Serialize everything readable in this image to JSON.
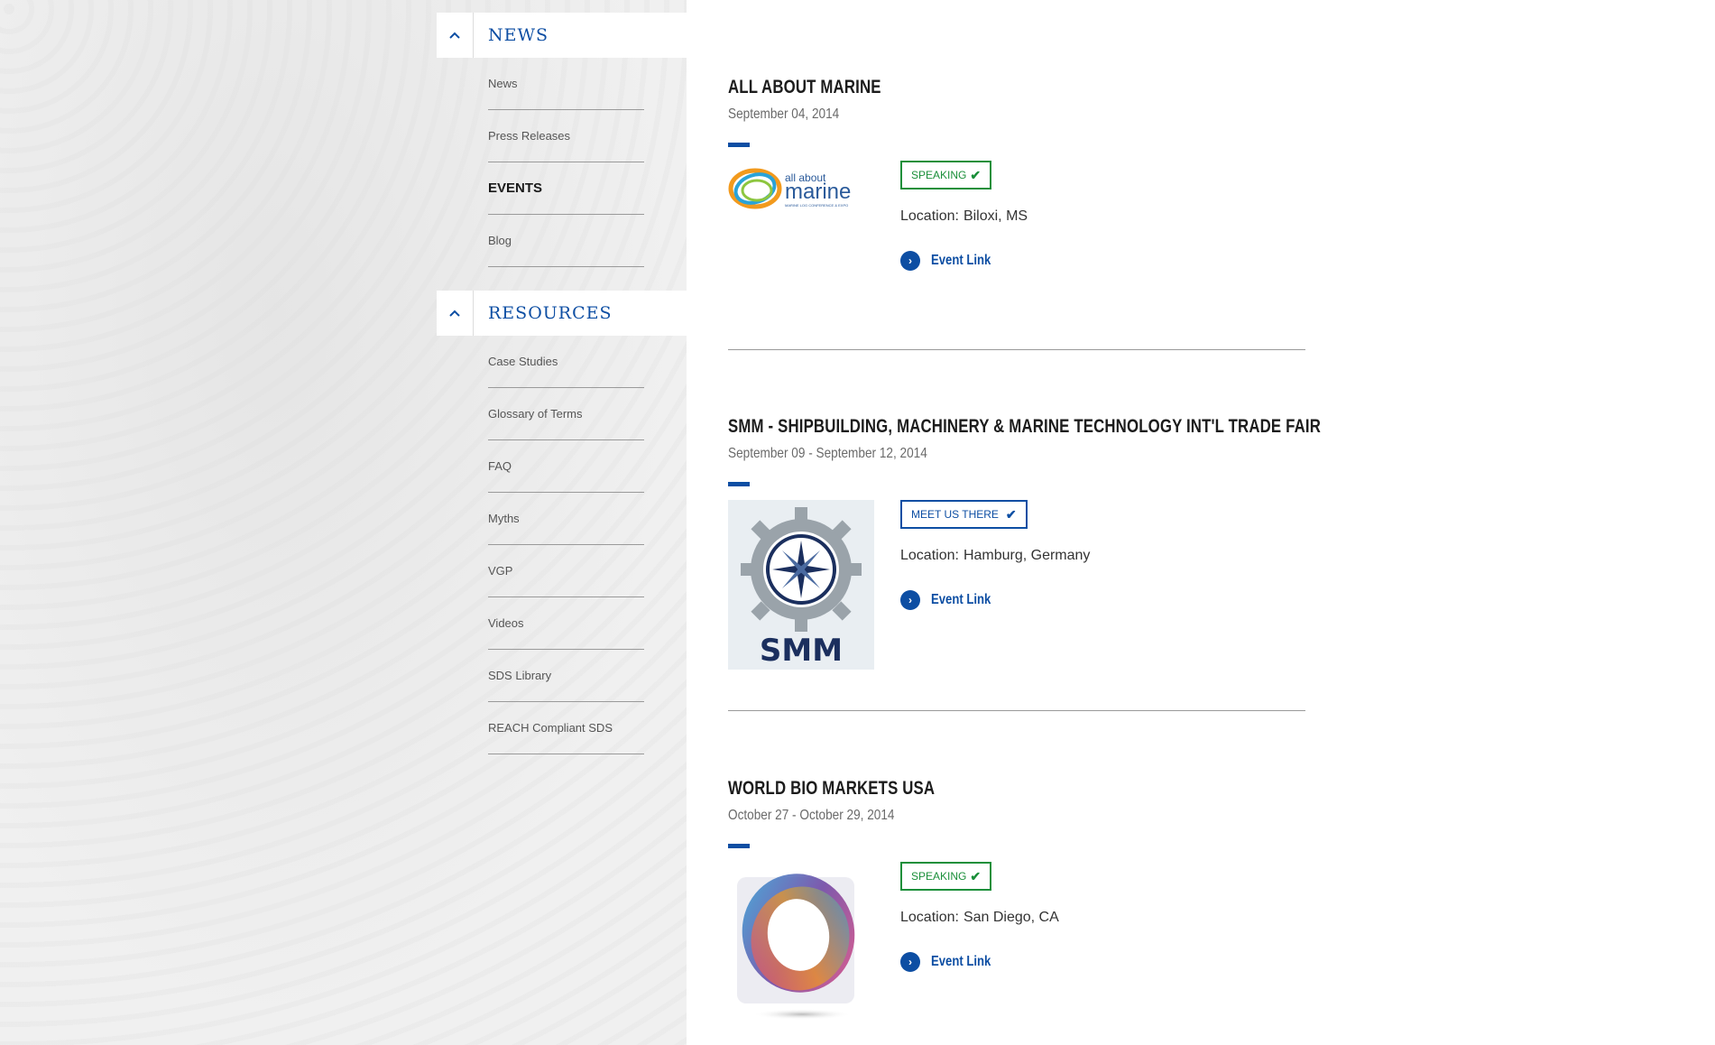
{
  "sidebar": {
    "news": {
      "title": "NEWS",
      "items": [
        {
          "label": "News",
          "active": false
        },
        {
          "label": "Press Releases",
          "active": false
        },
        {
          "label": "EVENTS",
          "active": true
        },
        {
          "label": "Blog",
          "active": false
        }
      ]
    },
    "resources": {
      "title": "RESOURCES",
      "items": [
        {
          "label": "Case Studies"
        },
        {
          "label": "Glossary of Terms"
        },
        {
          "label": "FAQ"
        },
        {
          "label": "Myths"
        },
        {
          "label": "VGP"
        },
        {
          "label": "Videos"
        },
        {
          "label": "SDS Library"
        },
        {
          "label": "REACH Compliant SDS"
        }
      ]
    }
  },
  "events": [
    {
      "title": "ALL ABOUT MARINE",
      "date": "September 04, 2014",
      "badge": "SPEAKING",
      "badge_color": "#1b8f3a",
      "location_label": "Location:",
      "location": "Biloxi, MS",
      "link_label": "Event Link",
      "logo": {
        "text_top": "all about",
        "text_main": "marine",
        "text_sub": "MARINE LOG CONFERENCE & EXPO"
      }
    },
    {
      "title": "SMM - SHIPBUILDING, MACHINERY & MARINE TECHNOLOGY INT'L TRADE FAIR",
      "date": "September 09 - September 12, 2014",
      "badge": "MEET US THERE",
      "badge_color": "#0d4ea3",
      "location_label": "Location:",
      "location": "Hamburg, Germany",
      "link_label": "Event Link",
      "logo": {
        "text_main": "SMM"
      }
    },
    {
      "title": "WORLD BIO MARKETS USA",
      "date": "October 27 - October 29, 2014",
      "badge": "SPEAKING",
      "badge_color": "#1b8f3a",
      "location_label": "Location:",
      "location": "San Diego, CA",
      "link_label": "Event Link",
      "logo": {}
    }
  ],
  "colors": {
    "accent": "#0d4ea3",
    "speaking": "#1b8f3a",
    "divider": "#9a9a9a"
  },
  "icons": {
    "collapse": "chevron-up-icon",
    "check": "checkmark-icon",
    "link": "chevron-right-circle-icon"
  }
}
